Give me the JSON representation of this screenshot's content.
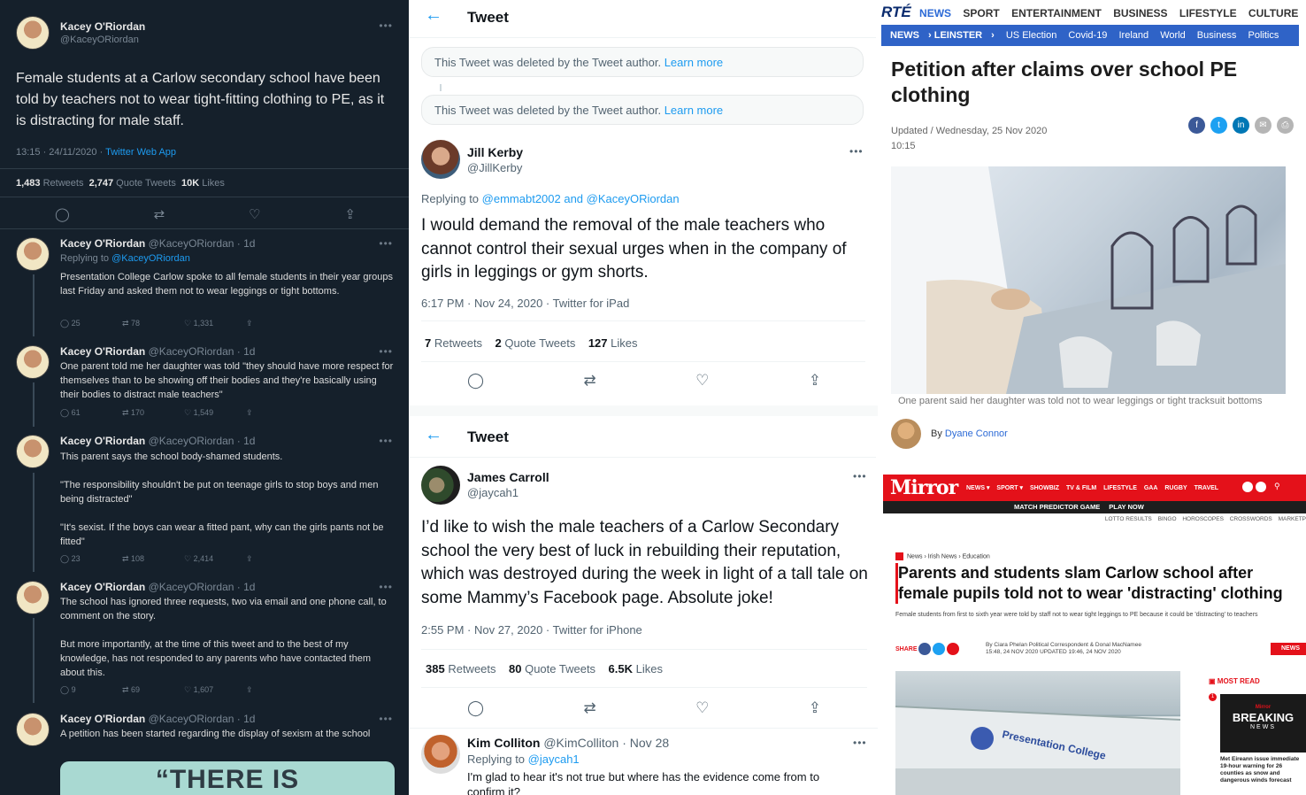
{
  "panel_a": {
    "main": {
      "name": "Kacey O'Riordan",
      "handle": "@KaceyORiordan",
      "text": "Female students at a Carlow secondary school have been told by teachers not to wear tight-fitting clothing to PE, as it is distracting for male staff.",
      "timestamp": "13:15 · 24/11/2020 · ",
      "source": "Twitter Web App",
      "retweets": "1,483",
      "retweets_label": "Retweets",
      "quotes": "2,747",
      "quotes_label": "Quote Tweets",
      "likes": "10K",
      "likes_label": "Likes"
    },
    "replies": [
      {
        "name": "Kacey O'Riordan",
        "meta": "@KaceyORiordan · 1d",
        "replying": "Replying to ",
        "replying_to": "@KaceyORiordan",
        "text": "Presentation College Carlow spoke to all female students in their year groups last Friday and asked them not to wear leggings or tight bottoms.",
        "c": "25",
        "r": "78",
        "l": "1,331"
      },
      {
        "name": "Kacey O'Riordan",
        "meta": "@KaceyORiordan · 1d",
        "text": "One parent told me her daughter was told \"they should have more respect for themselves than to be showing off their bodies and they're basically using their bodies to distract male teachers\"",
        "c": "61",
        "r": "170",
        "l": "1,549"
      },
      {
        "name": "Kacey O'Riordan",
        "meta": "@KaceyORiordan · 1d",
        "text": "This parent says the school body-shamed students.",
        "text2": "\"The responsibility shouldn't be put on teenage girls to stop boys and men being distracted\"",
        "text3": "\"It's sexist. If the boys can wear a fitted pant, why can the girls pants not be fitted\"",
        "c": "23",
        "r": "108",
        "l": "2,414"
      },
      {
        "name": "Kacey O'Riordan",
        "meta": "@KaceyORiordan · 1d",
        "text": "The school has ignored three requests, two via email and one phone call, to comment on the story.",
        "text2": "But more importantly, at the time of this tweet and to the best of my knowledge, has not responded to any parents who have contacted them about this.",
        "c": "9",
        "r": "69",
        "l": "1,607"
      },
      {
        "name": "Kacey O'Riordan",
        "meta": "@KaceyORiordan · 1d",
        "text": "A petition has been started regarding the display of sexism at the school",
        "card": "“THERE IS"
      }
    ]
  },
  "panel_b": {
    "header": "Tweet",
    "deleted_text": "This Tweet was deleted by the Tweet author. ",
    "learn_more": "Learn more",
    "name": "Jill Kerby",
    "handle": "@JillKerby",
    "replying": "Replying to ",
    "replying_to": "@emmabt2002 and @KaceyORiordan",
    "text": "I would demand the removal of the male teachers who cannot control their sexual urges when in the company of girls in leggings or gym shorts.",
    "meta": "6:17 PM · Nov 24, 2020 · Twitter for iPad",
    "retweets": "7",
    "retweets_label": "Retweets",
    "quotes": "2",
    "quotes_label": "Quote Tweets",
    "likes": "127",
    "likes_label": "Likes"
  },
  "panel_c": {
    "header": "Tweet",
    "name": "James Carroll",
    "handle": "@jaycah1",
    "text": "I’d like to wish the male teachers of a Carlow Secondary school the very best of luck in rebuilding their reputation, which was destroyed during the week in light of a tall tale on some Mammy’s Facebook page. Absolute joke!",
    "meta": "2:55 PM · Nov 27, 2020 · Twitter for iPhone",
    "retweets": "385",
    "retweets_label": "Retweets",
    "quotes": "80",
    "quotes_label": "Quote Tweets",
    "likes": "6.5K",
    "likes_label": "Likes",
    "reply": {
      "name": "Kim Colliton",
      "meta": "@KimColliton · Nov 28",
      "replying": "Replying to ",
      "replying_to": "@jaycah1",
      "text": "I'm glad to hear it's not true but where has the evidence come from to confirm it?"
    }
  },
  "panel_d": {
    "logo": "RTÉ",
    "top_nav": [
      "NEWS",
      "SPORT",
      "ENTERTAINMENT",
      "BUSINESS",
      "LIFESTYLE",
      "CULTURE"
    ],
    "sub_nav": [
      "NEWS",
      "› LEINSTER",
      "›",
      "US Election",
      "Covid-19",
      "Ireland",
      "World",
      "Business",
      "Politics"
    ],
    "headline": "Petition after claims over school PE clothing",
    "updated": "Updated / Wednesday, 25 Nov 2020",
    "time": "10:15",
    "caption": "One parent said her daughter was told not to wear leggings or tight tracksuit bottoms",
    "by": "By ",
    "author": "Dyane Connor",
    "share_colors": {
      "facebook": "#3b5998",
      "twitter": "#1da1f2",
      "linkedin": "#0077b5",
      "email": "#b5b5b5",
      "print": "#b5b5b5"
    }
  },
  "panel_e": {
    "logo": "Mirror",
    "nav": [
      "NEWS ▾",
      "SPORT ▾",
      "SHOWBIZ",
      "TV & FILM",
      "LIFESTYLE",
      "GAA",
      "RUGBY",
      "TRAVEL"
    ],
    "sub_nav": [
      "MATCH PREDICTOR GAME",
      "PLAY NOW"
    ],
    "tiny_nav": [
      "LOTTO RESULTS",
      "BINGO",
      "HOROSCOPES",
      "CROSSWORDS",
      "MARKETP"
    ],
    "breadcrumb": "News › Irish News › Education",
    "headline": "Parents and students slam Carlow school after female pupils told not to wear 'distracting' clothing",
    "standfirst": "Female students from first to sixth year were told by staff not to wear tight leggings to PE because it could be 'distracting' to teachers",
    "share": "SHARE",
    "authors": "By Ciara Phelan Political Correspondent & Donal MacNamee",
    "dates": "15:48, 24 NOV 2020   UPDATED 19:46, 24 NOV 2020",
    "news_button": "NEWS",
    "most_read": "MOST READ",
    "breaking_top": "Mirror",
    "breaking": "BREAKING",
    "breaking_sub": "NEWS",
    "mr_text": "Met Eireann issue immediate 19-hour warning for 26 counties as snow and dangerous winds forecast",
    "sign": "Presentation College",
    "accent": "#e4111a"
  }
}
